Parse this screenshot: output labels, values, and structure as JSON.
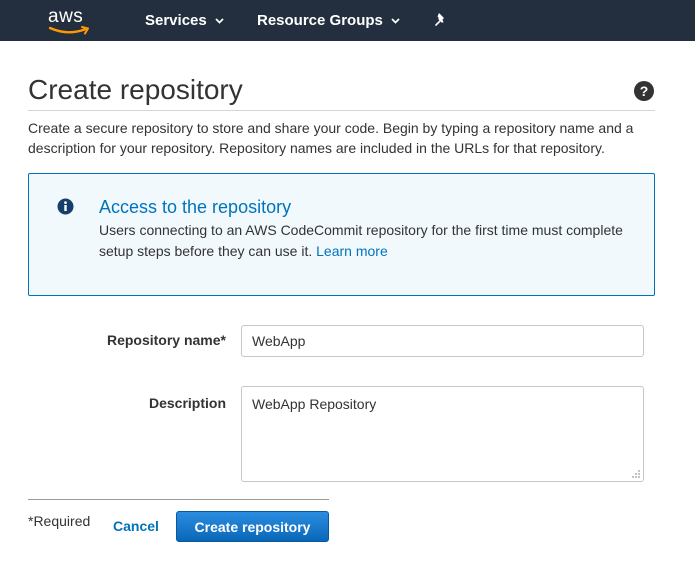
{
  "nav": {
    "logo_text": "aws",
    "services_label": "Services",
    "resource_groups_label": "Resource Groups",
    "pin_icon": "pushpin-icon",
    "chevron_icon": "chevron-down-icon"
  },
  "page": {
    "title": "Create repository",
    "help_icon": "question-circle-icon",
    "intro": "Create a secure repository to store and share your code. Begin by typing a repository name and a description for your repository. Repository names are included in the URLs for that repository."
  },
  "info": {
    "icon": "info-circle-icon",
    "title": "Access to the repository",
    "body": "Users connecting to an AWS CodeCommit repository for the first time must complete setup steps before they can use it.",
    "link": "Learn more"
  },
  "form": {
    "repo_name_label": "Repository name*",
    "repo_name_value": "WebApp",
    "description_label": "Description",
    "description_value": "WebApp Repository"
  },
  "footer": {
    "required_note": "*Required",
    "cancel_label": "Cancel",
    "create_label": "Create repository"
  },
  "colors": {
    "nav_bg": "#232f3e",
    "link_blue": "#0073bb",
    "info_bg": "#f1f9fd",
    "primary_button": "#0a6fc2",
    "aws_orange": "#ff9900"
  }
}
